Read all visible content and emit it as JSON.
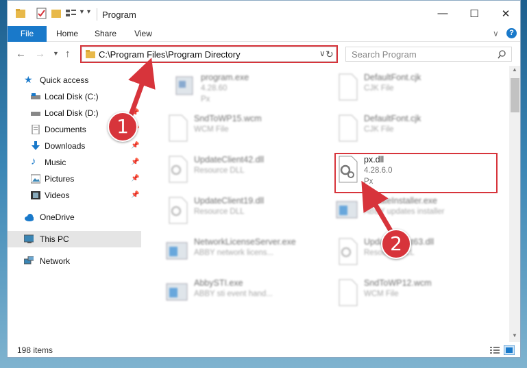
{
  "window": {
    "title": "Program",
    "minimize": "—",
    "maximize": "☐",
    "close": "✕"
  },
  "ribbon": {
    "tabs": [
      "File",
      "Home",
      "Share",
      "View"
    ],
    "help": "?"
  },
  "navbar": {
    "address": "C:\\Program Files\\Program Directory",
    "search_placeholder": "Search Program"
  },
  "sidebar": {
    "items": [
      {
        "label": "Quick access",
        "icon": "star-icon"
      },
      {
        "label": "Local Disk (C:)",
        "icon": "drive-icon"
      },
      {
        "label": "Local Disk (D:)",
        "icon": "drive-icon"
      },
      {
        "label": "Documents",
        "icon": "documents-icon"
      },
      {
        "label": "Downloads",
        "icon": "download-icon"
      },
      {
        "label": "Music",
        "icon": "music-icon"
      },
      {
        "label": "Pictures",
        "icon": "pictures-icon"
      },
      {
        "label": "Videos",
        "icon": "videos-icon"
      },
      {
        "label": "OneDrive",
        "icon": "cloud-icon"
      },
      {
        "label": "This PC",
        "icon": "computer-icon"
      },
      {
        "label": "Network",
        "icon": "network-icon"
      }
    ]
  },
  "files": {
    "items": [
      {
        "name": "program.exe",
        "line2": "4.28.60",
        "line3": "Px"
      },
      {
        "name": "DefaultFont.cjk",
        "line2": "CJK File",
        "line3": ""
      },
      {
        "name": "SndToWP15.wcm",
        "line2": "WCM File",
        "line3": ""
      },
      {
        "name": "DefaultFont.cjk",
        "line2": "CJK File",
        "line3": ""
      },
      {
        "name": "UpdateClient42.dll",
        "line2": "Resource DLL",
        "line3": ""
      },
      {
        "name": "px.dll",
        "line2": "4.28.6.0",
        "line3": "Px"
      },
      {
        "name": "UpdateClient19.dll",
        "line2": "Resource DLL",
        "line3": ""
      },
      {
        "name": "UpdateInstaller.exe",
        "line2": "ABBY updates installer",
        "line3": ""
      },
      {
        "name": "NetworkLicenseServer.exe",
        "line2": "ABBY network licens...",
        "line3": ""
      },
      {
        "name": "UpdateClient63.dll",
        "line2": "Resource DLL",
        "line3": ""
      },
      {
        "name": "AbbySTI.exe",
        "line2": "ABBY sti event hand...",
        "line3": ""
      },
      {
        "name": "SndToWP12.wcm",
        "line2": "WCM File",
        "line3": ""
      }
    ]
  },
  "status": {
    "item_count": "198 items"
  },
  "annotations": {
    "step1": "1",
    "step2": "2"
  },
  "colors": {
    "accent": "#1979ca",
    "highlight": "#d7343b"
  }
}
